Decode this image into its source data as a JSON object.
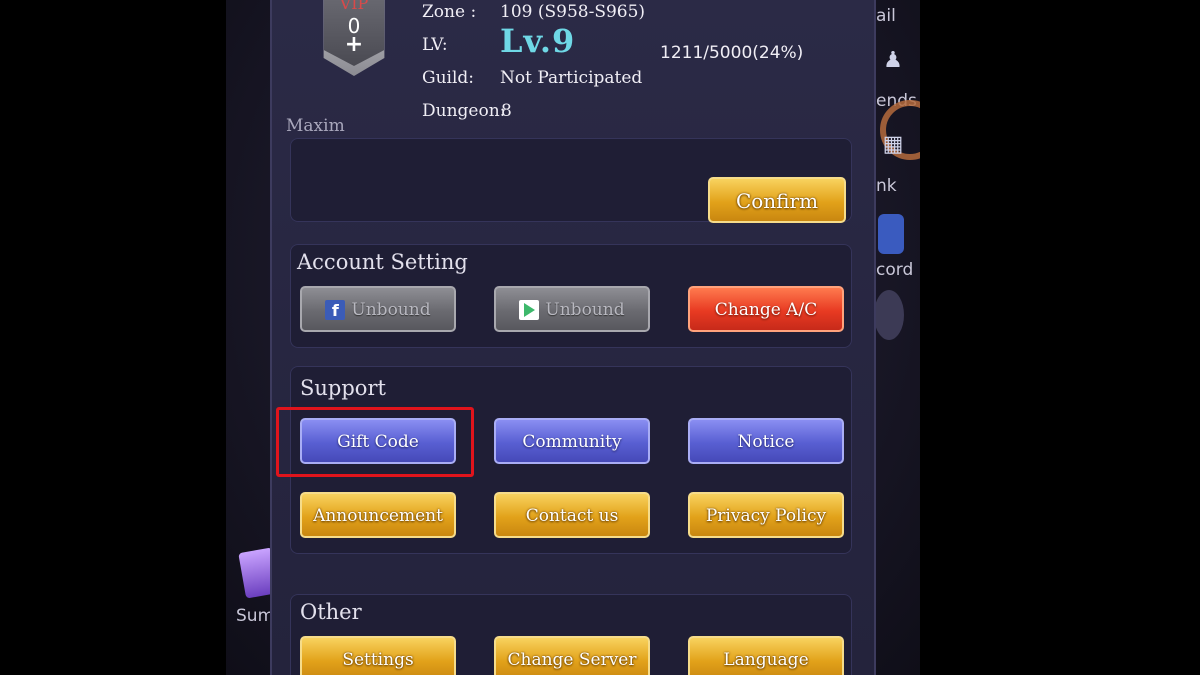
{
  "player": {
    "vip_label": "VIP",
    "vip_level": "0",
    "vip_plus": "+",
    "zone_label": "Zone :",
    "zone_value": "109 (S958-S965)",
    "lv_label": "LV:",
    "lv_value": "Lv.9",
    "exp": "1211/5000(24%)",
    "guild_label": "Guild:",
    "guild_value": "Not Participated",
    "dungeon_label": "Dungeon:",
    "dungeon_value": "8",
    "name": "Maxim"
  },
  "name_box": {
    "confirm_label": "Confirm"
  },
  "account": {
    "title": "Account Setting",
    "facebook_label": "Unbound",
    "facebook_icon": "f",
    "google_label": "Unbound",
    "change_label": "Change A/C"
  },
  "support": {
    "title": "Support",
    "buttons": [
      "Gift Code",
      "Community",
      "Notice",
      "Announcement",
      "Contact us",
      "Privacy Policy"
    ]
  },
  "other": {
    "title": "Other",
    "buttons": [
      "Settings",
      "Change Server",
      "Language"
    ]
  },
  "side_right": [
    "ail",
    "ends",
    "nk",
    "cord"
  ],
  "side_left": [
    "Sum"
  ],
  "colors": {
    "gold": "#e2a21a",
    "blue": "#585fd2",
    "red": "#e83a22",
    "gray": "#6a6a70",
    "highlight": "#e0141c",
    "lv": "#6fd8e6"
  }
}
